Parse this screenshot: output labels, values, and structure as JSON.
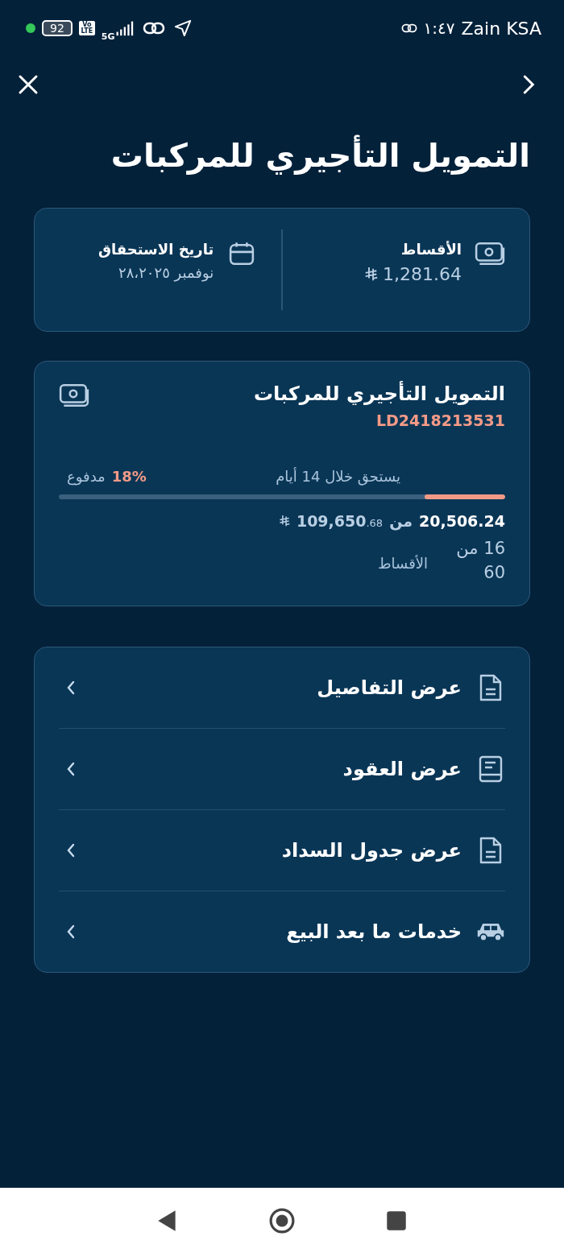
{
  "status_bar": {
    "carrier": "Zain KSA",
    "time": "١:٤٧",
    "battery": "92",
    "volte": "Vo LTE",
    "network": "5G"
  },
  "header": {
    "title": "التمويل التأجيري للمركبات"
  },
  "summary": {
    "installment_label": "الأقساط",
    "installment_amount": "1,281.64",
    "due_label": "تاريخ الاستحقاق",
    "due_date": "نوفمبر ٢٨،٢٠٢٥"
  },
  "loan": {
    "title": "التمويل التأجيري للمركبات",
    "reference": "LD2418213531",
    "due_text": "يستحق خلال 14 أيام",
    "paid_percent": "18%",
    "paid_label": "مدفوع",
    "level": 0.18,
    "paid_amount": "20,506.24",
    "of_word": "من",
    "total_whole": "109,650",
    "total_fraction": ".68",
    "installments_count": "16 من 60",
    "installments_label": "الأقساط"
  },
  "menu": [
    {
      "label": "عرض التفاصيل",
      "kind": "document"
    },
    {
      "label": "عرض العقود",
      "kind": "book"
    },
    {
      "label": "عرض جدول السداد",
      "kind": "document"
    },
    {
      "label": "خدمات ما بعد البيع",
      "kind": "car"
    }
  ]
}
